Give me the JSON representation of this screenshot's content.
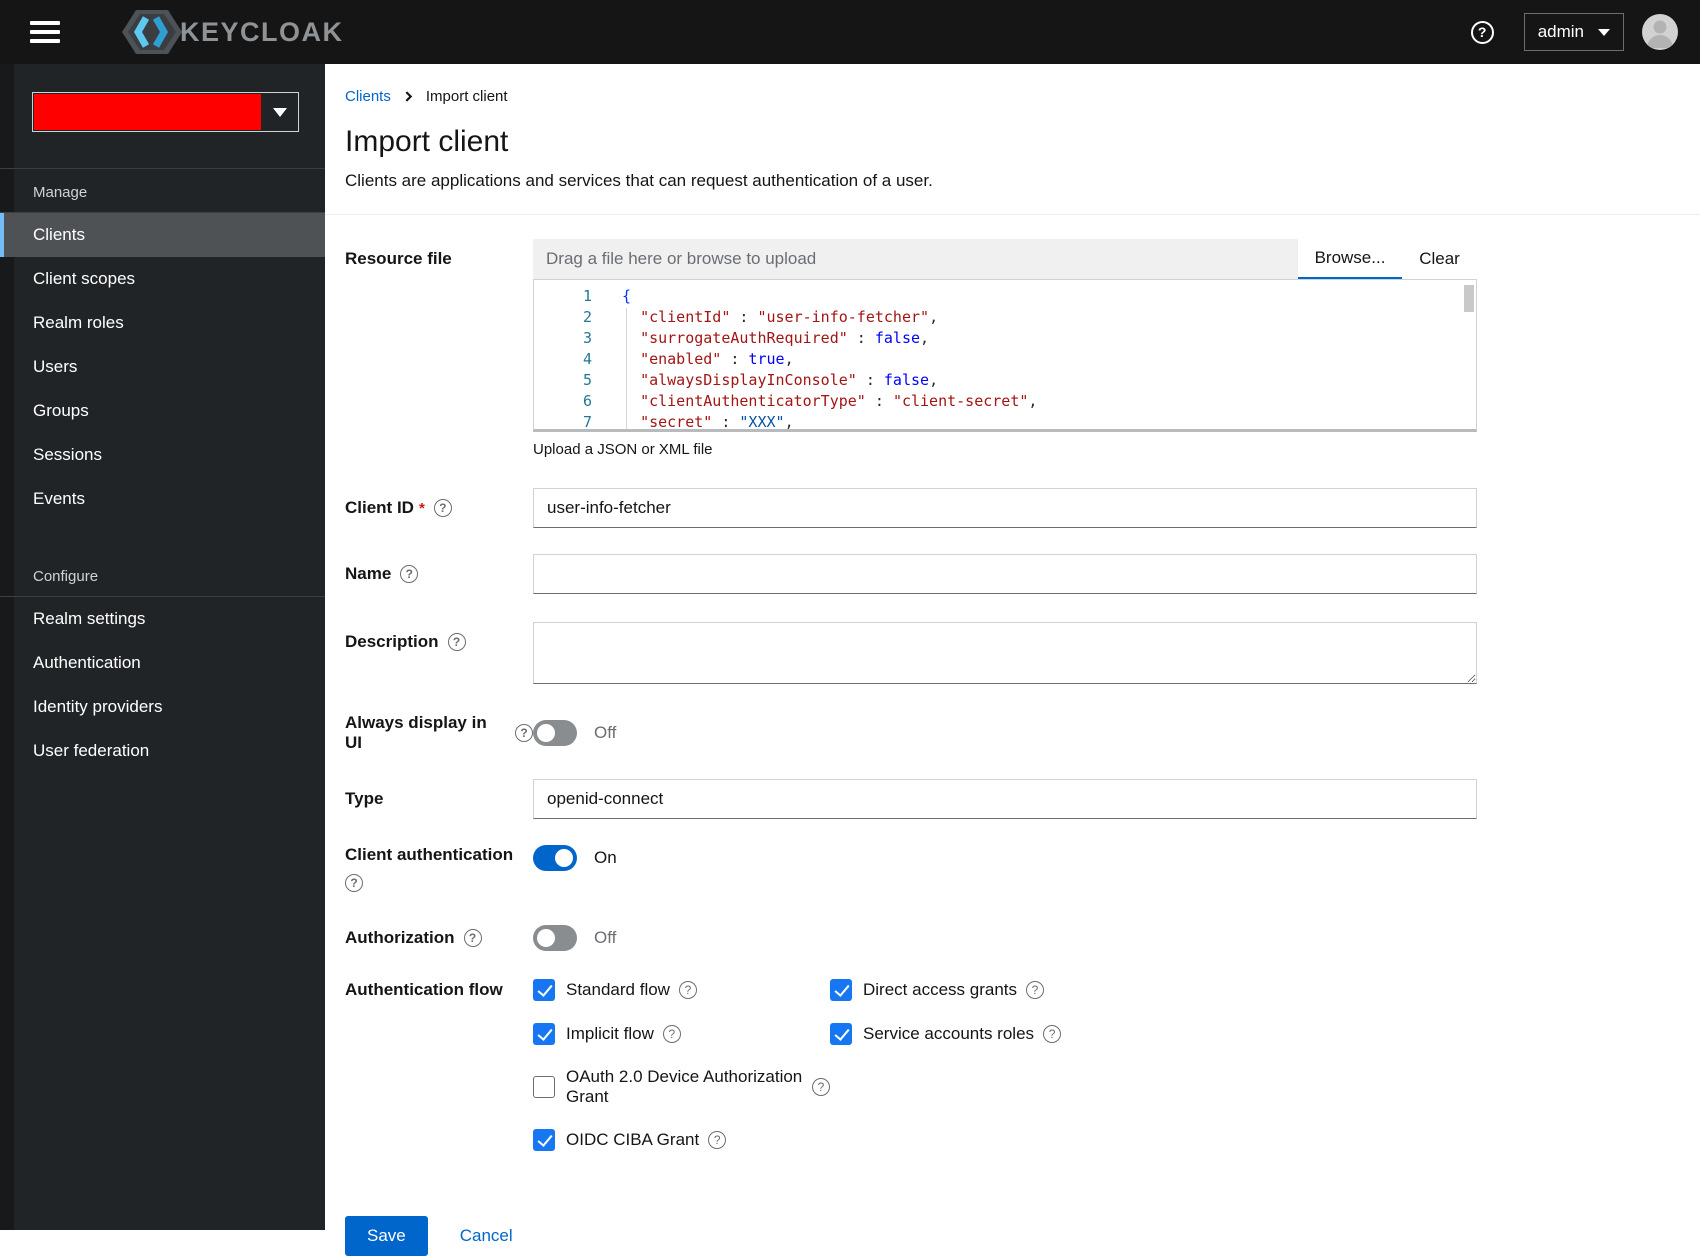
{
  "topbar": {
    "brand": "KEYCLOAK",
    "user": "admin"
  },
  "sidebar": {
    "sections": [
      {
        "label": "Manage",
        "items": [
          {
            "label": "Clients",
            "selected": true
          },
          {
            "label": "Client scopes"
          },
          {
            "label": "Realm roles"
          },
          {
            "label": "Users"
          },
          {
            "label": "Groups"
          },
          {
            "label": "Sessions"
          },
          {
            "label": "Events"
          }
        ]
      },
      {
        "label": "Configure",
        "items": [
          {
            "label": "Realm settings"
          },
          {
            "label": "Authentication"
          },
          {
            "label": "Identity providers"
          },
          {
            "label": "User federation"
          }
        ]
      }
    ]
  },
  "breadcrumb": {
    "parent": "Clients",
    "current": "Import client"
  },
  "header": {
    "title": "Import client",
    "subtitle": "Clients are applications and services that can request authentication of a user."
  },
  "form": {
    "resource_file": {
      "label": "Resource file",
      "placeholder": "Drag a file here or browse to upload",
      "browse_label": "Browse...",
      "clear_label": "Clear",
      "helper": "Upload a JSON or XML file",
      "code_lines": [
        {
          "num": "1",
          "tokens": [
            {
              "c": "brace",
              "t": "{"
            }
          ]
        },
        {
          "num": "2",
          "tokens": [
            {
              "c": "p",
              "t": "  "
            },
            {
              "c": "key",
              "t": "\"clientId\""
            },
            {
              "c": "p",
              "t": " : "
            },
            {
              "c": "str",
              "t": "\"user-info-fetcher\""
            },
            {
              "c": "p",
              "t": ","
            }
          ]
        },
        {
          "num": "3",
          "tokens": [
            {
              "c": "p",
              "t": "  "
            },
            {
              "c": "key",
              "t": "\"surrogateAuthRequired\""
            },
            {
              "c": "p",
              "t": " : "
            },
            {
              "c": "bool",
              "t": "false"
            },
            {
              "c": "p",
              "t": ","
            }
          ]
        },
        {
          "num": "4",
          "tokens": [
            {
              "c": "p",
              "t": "  "
            },
            {
              "c": "key",
              "t": "\"enabled\""
            },
            {
              "c": "p",
              "t": " : "
            },
            {
              "c": "bool",
              "t": "true"
            },
            {
              "c": "p",
              "t": ","
            }
          ]
        },
        {
          "num": "5",
          "tokens": [
            {
              "c": "p",
              "t": "  "
            },
            {
              "c": "key",
              "t": "\"alwaysDisplayInConsole\""
            },
            {
              "c": "p",
              "t": " : "
            },
            {
              "c": "bool",
              "t": "false"
            },
            {
              "c": "p",
              "t": ","
            }
          ]
        },
        {
          "num": "6",
          "tokens": [
            {
              "c": "p",
              "t": "  "
            },
            {
              "c": "key",
              "t": "\"clientAuthenticatorType\""
            },
            {
              "c": "p",
              "t": " : "
            },
            {
              "c": "str",
              "t": "\"client-secret\""
            },
            {
              "c": "p",
              "t": ","
            }
          ]
        },
        {
          "num": "7",
          "tokens": [
            {
              "c": "p",
              "t": "  "
            },
            {
              "c": "key",
              "t": "\"secret\""
            },
            {
              "c": "p",
              "t": " : "
            },
            {
              "c": "strb",
              "t": "\"XXX\""
            },
            {
              "c": "p",
              "t": ","
            }
          ]
        }
      ]
    },
    "client_id": {
      "label": "Client ID",
      "required": "*",
      "value": "user-info-fetcher"
    },
    "name": {
      "label": "Name",
      "value": ""
    },
    "description": {
      "label": "Description",
      "value": ""
    },
    "always_display": {
      "label": "Always display in UI",
      "state": "Off"
    },
    "type": {
      "label": "Type",
      "value": "openid-connect"
    },
    "client_auth": {
      "label": "Client authentication",
      "state": "On"
    },
    "authorization": {
      "label": "Authorization",
      "state": "Off"
    },
    "auth_flow": {
      "label": "Authentication flow",
      "checkboxes": [
        {
          "label": "Standard flow",
          "checked": true
        },
        {
          "label": "Direct access grants",
          "checked": true
        },
        {
          "label": "Implicit flow",
          "checked": true
        },
        {
          "label": "Service accounts roles",
          "checked": true
        },
        {
          "label": "OAuth 2.0 Device Authorization Grant",
          "checked": false
        },
        {
          "label": "OIDC CIBA Grant",
          "checked": true
        }
      ]
    },
    "actions": {
      "save": "Save",
      "cancel": "Cancel"
    }
  },
  "colors": {
    "primary": "#0066cc",
    "link": "#0066cc",
    "checkbox": "#1777f2",
    "topbar_bg": "#151515",
    "sidebar_bg": "#212427",
    "nav_selected_bg": "#4f5255",
    "nav_selected_border": "#73bcf7",
    "realm_redaction": "#ff0000",
    "code_key": "#a31515",
    "code_bool": "#0000ff",
    "code_line_number": "#237893"
  }
}
